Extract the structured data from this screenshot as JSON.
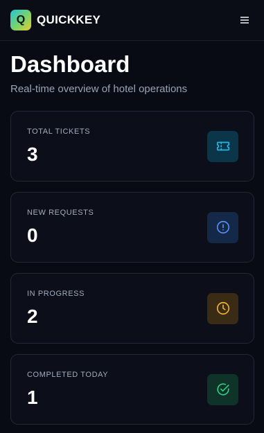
{
  "header": {
    "logo_letter": "Q",
    "brand": "QUICKKEY",
    "menu_icon": "hamburger-menu-icon"
  },
  "page": {
    "title": "Dashboard",
    "subtitle": "Real-time overview of hotel operations"
  },
  "stats": [
    {
      "label": "TOTAL TICKETS",
      "value": "3",
      "icon": "ticket-icon",
      "icon_color": "#22b8e6",
      "icon_bg": "#0b3548"
    },
    {
      "label": "NEW REQUESTS",
      "value": "0",
      "icon": "alert-circle-icon",
      "icon_color": "#5b8ff5",
      "icon_bg": "#142848"
    },
    {
      "label": "IN PROGRESS",
      "value": "2",
      "icon": "clock-icon",
      "icon_color": "#f0b42a",
      "icon_bg": "#3a2c14"
    },
    {
      "label": "COMPLETED TODAY",
      "value": "1",
      "icon": "check-circle-icon",
      "icon_color": "#2fcf86",
      "icon_bg": "#0f3328"
    }
  ]
}
